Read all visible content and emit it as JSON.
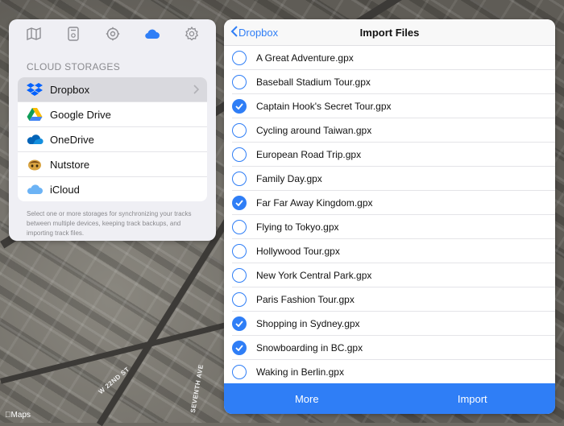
{
  "map": {
    "credit": "Maps",
    "streets": [
      "W 22ND ST",
      "SEVENTH AVE"
    ]
  },
  "left_panel": {
    "toolbar": [
      {
        "icon": "map-icon"
      },
      {
        "icon": "device-icon"
      },
      {
        "icon": "settings-gear-icon"
      },
      {
        "icon": "cloud-icon",
        "active": true
      },
      {
        "icon": "gear-icon"
      }
    ],
    "section_title": "CLOUD STORAGES",
    "storages": [
      {
        "label": "Dropbox",
        "icon": "dropbox-icon",
        "selected": true
      },
      {
        "label": "Google Drive",
        "icon": "google-drive-icon",
        "selected": false
      },
      {
        "label": "OneDrive",
        "icon": "onedrive-icon",
        "selected": false
      },
      {
        "label": "Nutstore",
        "icon": "nutstore-icon",
        "selected": false
      },
      {
        "label": "iCloud",
        "icon": "icloud-icon",
        "selected": false
      }
    ],
    "footnote": "Select one or more storages for synchronizing your tracks between multiple devices, keeping track backups, and importing track files."
  },
  "right_panel": {
    "back_label": "Dropbox",
    "title": "Import Files",
    "files": [
      {
        "name": "A Great Adventure.gpx",
        "checked": false
      },
      {
        "name": "Baseball Stadium Tour.gpx",
        "checked": false
      },
      {
        "name": "Captain Hook's Secret Tour.gpx",
        "checked": true
      },
      {
        "name": "Cycling around Taiwan.gpx",
        "checked": false
      },
      {
        "name": "European Road Trip.gpx",
        "checked": false
      },
      {
        "name": "Family Day.gpx",
        "checked": false
      },
      {
        "name": "Far Far Away Kingdom.gpx",
        "checked": true
      },
      {
        "name": "Flying to Tokyo.gpx",
        "checked": false
      },
      {
        "name": "Hollywood Tour.gpx",
        "checked": false
      },
      {
        "name": "New York Central Park.gpx",
        "checked": false
      },
      {
        "name": "Paris Fashion Tour.gpx",
        "checked": false
      },
      {
        "name": "Shopping in Sydney.gpx",
        "checked": true
      },
      {
        "name": "Snowboarding in BC.gpx",
        "checked": true
      },
      {
        "name": "Waking in Berlin.gpx",
        "checked": false
      }
    ],
    "more_label": "More",
    "import_label": "Import",
    "accent": "#2f7ef6"
  }
}
